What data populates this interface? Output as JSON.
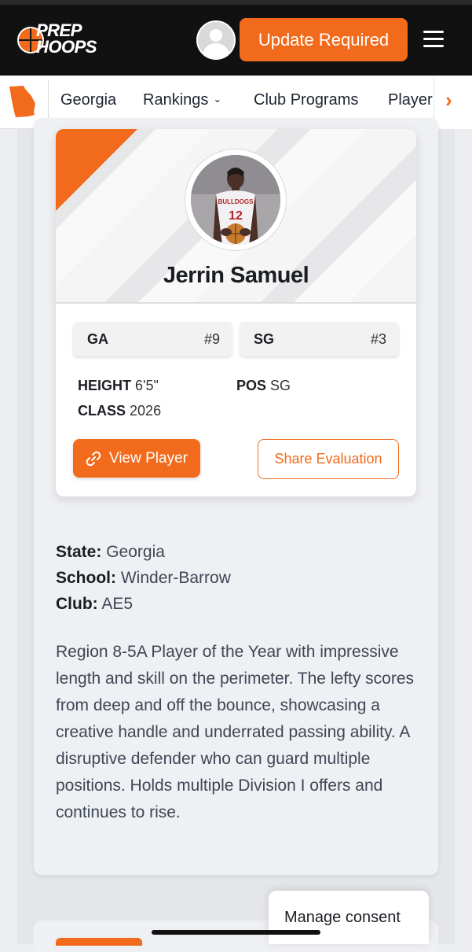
{
  "header": {
    "logo_line1": "PREP",
    "logo_line2": "HOOPS",
    "update_label": "Update Required",
    "accent": "#f26a1b"
  },
  "subnav": {
    "items": [
      {
        "label": "Georgia"
      },
      {
        "label": "Rankings",
        "icon": "chevron-down-icon"
      },
      {
        "label": "Club Programs"
      },
      {
        "label": "Player"
      }
    ],
    "next_icon": "chevron-right-icon"
  },
  "player": {
    "name": "Jerrin Samuel",
    "jersey_text": "BULLDOGS",
    "jersey_number": "12",
    "ranks": [
      {
        "label": "GA",
        "value": "#9"
      },
      {
        "label": "SG",
        "value": "#3"
      }
    ],
    "height_label": "HEIGHT",
    "height": "6'5\"",
    "pos_label": "POS",
    "pos": "SG",
    "class_label": "CLASS",
    "class": "2026",
    "view_label": "View Player",
    "share_label": "Share Evaluation"
  },
  "details": {
    "state_label": "State:",
    "state": "Georgia",
    "school_label": "School:",
    "school": "Winder-Barrow",
    "club_label": "Club:",
    "club": "AE5",
    "evaluation": "Region 8-5A Player of the Year with impressive length and skill on the perimeter. The lefty scores from deep and off the bounce, showcasing a creative handle and underrated passing ability. A disruptive defender who can guard multiple positions. Holds multiple Division I offers and continues to rise."
  },
  "consent": {
    "label": "Manage consent"
  }
}
